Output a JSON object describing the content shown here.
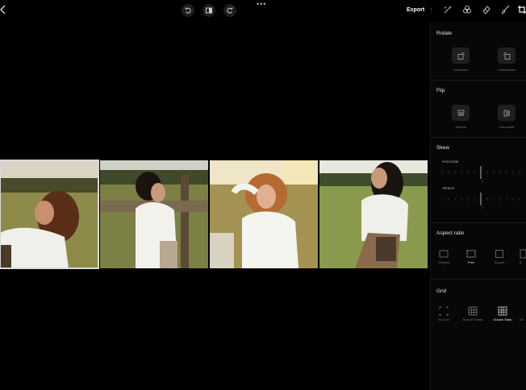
{
  "topbar": {
    "dots": "•••",
    "export_label": "Export",
    "icons": [
      "undo-icon",
      "compare-icon",
      "redo-icon",
      "magic-icon",
      "palette-icon",
      "eraser-icon",
      "brush-icon",
      "crop-icon"
    ]
  },
  "panel": {
    "rotate": {
      "title": "Rotate",
      "clockwise": "Clockwise",
      "counterclockwise": "Counterwise"
    },
    "flip": {
      "title": "Flip",
      "vertical": "Vertical",
      "horizontal": "Horizontal"
    },
    "skew": {
      "title": "Skew",
      "horizontal": "Horizontal",
      "vertical": "Vertical",
      "horizontal_value": "0",
      "vertical_value": "0"
    },
    "aspect_ratio": {
      "title": "Aspect ratio",
      "options": [
        "Original",
        "Free",
        "Square",
        "S"
      ],
      "selected": "Free"
    },
    "grid": {
      "title": "Grid",
      "options": [
        "No Grid",
        "Rule of Thirds",
        "Golden Ratio",
        "Gr"
      ],
      "selected": "Golden Ratio"
    }
  },
  "colors": {
    "background": "#000000",
    "panel": "#070707",
    "button": "#1f1f1f",
    "selected_outline": "#d8d8d8"
  }
}
